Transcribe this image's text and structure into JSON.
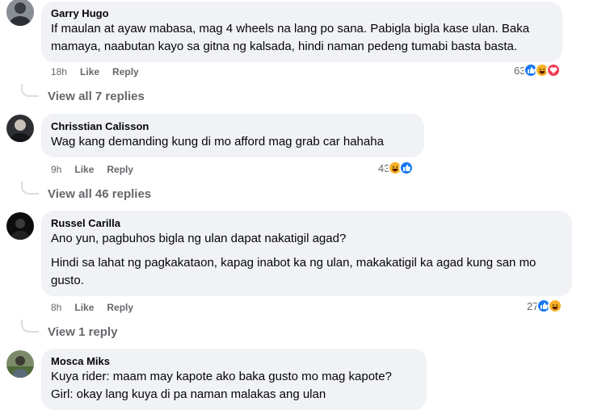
{
  "comments": [
    {
      "author": "Garry Hugo",
      "lines": [
        "If maulan at ayaw mabasa, mag 4 wheels na lang po sana. Pabigla bigla kase ulan. Baka mamaya, naabutan kayo sa gitna ng kalsada, hindi naman pedeng tumabi basta basta."
      ],
      "time": "18h",
      "like_label": "Like",
      "reply_label": "Reply",
      "reaction_count": "63",
      "reactions": [
        "like-icon",
        "haha-icon",
        "love-icon"
      ],
      "view_replies": "View all 7 replies"
    },
    {
      "author": "Chrisstian Calisson",
      "lines": [
        "Wag kang demanding kung di mo afford mag grab car hahaha"
      ],
      "time": "9h",
      "like_label": "Like",
      "reply_label": "Reply",
      "reaction_count": "43",
      "reactions": [
        "haha-icon",
        "like-icon"
      ],
      "view_replies": "View all 46 replies"
    },
    {
      "author": "Russel Carilla",
      "lines": [
        "Ano yun, pagbuhos bigla ng ulan dapat nakatigil agad?",
        "Hindi sa lahat ng pagkakataon, kapag inabot ka ng ulan, makakatigil ka agad kung san mo gusto."
      ],
      "time": "8h",
      "like_label": "Like",
      "reply_label": "Reply",
      "reaction_count": "27",
      "reactions": [
        "like-icon",
        "haha-icon"
      ],
      "view_replies": "View 1 reply"
    },
    {
      "author": "Mosca Miks",
      "lines": [
        "Kuya rider: maam may kapote ako baka gusto mo mag kapote?",
        "Girl: okay lang kuya di pa naman malakas ang ulan"
      ]
    }
  ],
  "colors": {
    "bubble": "#f0f2f5",
    "meta_text": "#65676b",
    "like_blue": "#1877f2",
    "haha_yellow": "#f7b125",
    "love_red": "#f33e58"
  }
}
